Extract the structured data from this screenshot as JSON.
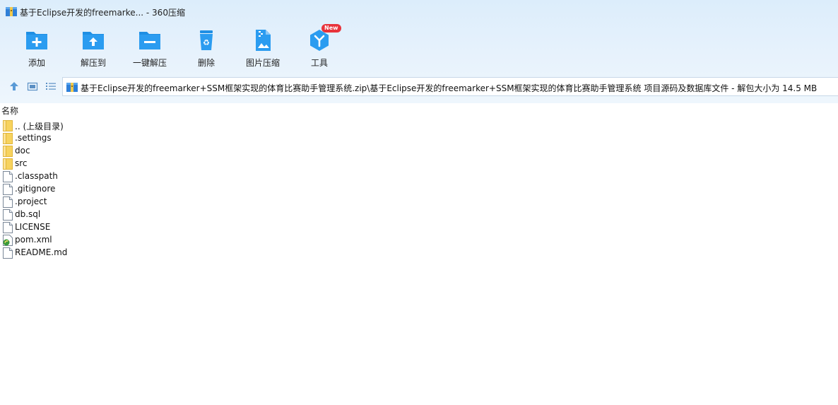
{
  "window": {
    "title": "基于Eclipse开发的freemarke... - 360压缩"
  },
  "toolbar": {
    "items": [
      {
        "label": "添加",
        "icon": "add-folder-icon"
      },
      {
        "label": "解压到",
        "icon": "extract-to-icon"
      },
      {
        "label": "一键解压",
        "icon": "one-click-extract-icon"
      },
      {
        "label": "删除",
        "icon": "delete-icon"
      },
      {
        "label": "图片压缩",
        "icon": "image-compress-icon"
      },
      {
        "label": "工具",
        "icon": "tools-icon",
        "badge": "New"
      }
    ]
  },
  "navbar": {
    "path": "基于Eclipse开发的freemarker+SSM框架实现的体育比赛助手管理系统.zip\\基于Eclipse开发的freemarker+SSM框架实现的体育比赛助手管理系统 项目源码及数据库文件 - 解包大小为 14.5 MB"
  },
  "columns": {
    "name": "名称"
  },
  "files": [
    {
      "name": ".. (上级目录)",
      "type": "folder"
    },
    {
      "name": ".settings",
      "type": "folder"
    },
    {
      "name": "doc",
      "type": "folder"
    },
    {
      "name": "src",
      "type": "folder"
    },
    {
      "name": ".classpath",
      "type": "file"
    },
    {
      "name": ".gitignore",
      "type": "file"
    },
    {
      "name": ".project",
      "type": "file"
    },
    {
      "name": "db.sql",
      "type": "file"
    },
    {
      "name": "LICENSE",
      "type": "file"
    },
    {
      "name": "pom.xml",
      "type": "xml"
    },
    {
      "name": "README.md",
      "type": "file"
    }
  ],
  "colors": {
    "accent": "#1f8fe4",
    "folder": "#f7d35e",
    "badge": "#e8333b"
  }
}
